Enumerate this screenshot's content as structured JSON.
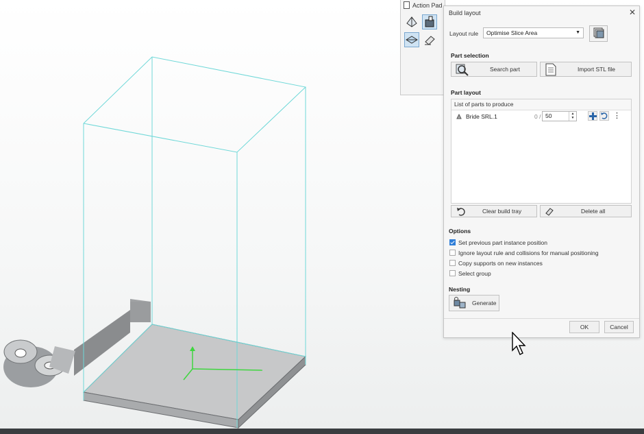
{
  "action_pad": {
    "title": "Action Pad"
  },
  "dialog": {
    "title": "Build layout",
    "layout_rule": {
      "label": "Layout rule",
      "value": "Optimise Slice Area"
    },
    "part_selection": {
      "heading": "Part selection",
      "search_button": "Search part",
      "import_button": "Import STL file"
    },
    "part_layout": {
      "heading": "Part layout",
      "list_header": "List of parts to produce",
      "parts": [
        {
          "name": "Bride SRL.1",
          "produced": "0 /",
          "quantity": "50"
        }
      ],
      "clear_button": "Clear build tray",
      "delete_button": "Delete all"
    },
    "options": {
      "heading": "Options",
      "items": [
        {
          "label": "Set previous part instance position",
          "checked": true
        },
        {
          "label": "Ignore layout rule and collisions for manual positioning",
          "checked": false
        },
        {
          "label": "Copy supports on new instances",
          "checked": false
        },
        {
          "label": "Select group",
          "checked": false
        }
      ]
    },
    "nesting": {
      "heading": "Nesting",
      "generate_button": "Generate"
    },
    "ok_button": "OK",
    "cancel_button": "Cancel"
  },
  "colors": {
    "bounding_box": "#6fd8d8",
    "axis": "#3fd63f",
    "checkbox_accent": "#2f7ed8"
  },
  "icons": [
    "document-icon",
    "plane-view-icon",
    "part-tool-icon",
    "tray-icon",
    "eraser-icon",
    "parts-stack-icon",
    "magnifier-icon",
    "stl-file-icon",
    "plus-icon",
    "undo-icon",
    "more-icon",
    "delete-icon",
    "generate-icon",
    "mouse-cursor-icon"
  ]
}
